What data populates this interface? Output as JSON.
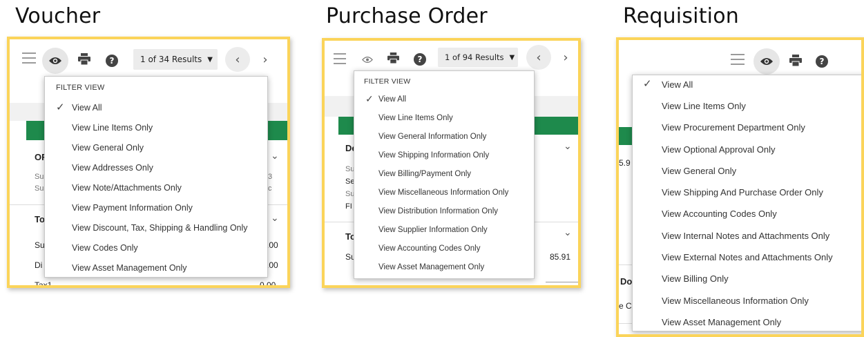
{
  "panels": {
    "voucher": {
      "title": "Voucher",
      "results_label": "1 of 34 Results",
      "filter_header": "FILTER VIEW",
      "items": [
        "View All",
        "View Line Items Only",
        "View General Only",
        "View Addresses Only",
        "View Note/Attachments Only",
        "View Payment Information Only",
        "View Discount, Tax, Shipping & Handling Only",
        "View Codes Only",
        "View Asset Management Only"
      ],
      "selected_item": "View All",
      "background_text": {
        "section1": "OF",
        "sub1": "Su",
        "sub2": "Su",
        "val1": "3",
        "val2": "c",
        "section2": "To",
        "row1": "Su",
        "row1_val": ".00",
        "row2": "Di",
        "row2_val": ".00",
        "row3": "Tax1",
        "row3_val": "0.00"
      }
    },
    "purchase_order": {
      "title": "Purchase Order",
      "results_label": "1 of 94 Results",
      "filter_header": "FILTER VIEW",
      "items": [
        "View All",
        "View Line Items Only",
        "View General Information Only",
        "View Shipping Information Only",
        "View Billing/Payment Only",
        "View Miscellaneous Information Only",
        "View Distribution Information Only",
        "View Supplier Information Only",
        "View Accounting Codes Only",
        "View Asset Management Only"
      ],
      "selected_item": "View All",
      "background_text": {
        "section1": "De",
        "sub1": "Su",
        "sub2": "Se",
        "sub3": "Su",
        "sub4": "FI",
        "section2": "To",
        "row1": "Su",
        "row1_val": "85.91"
      }
    },
    "requisition": {
      "title": "Requisition",
      "items": [
        "View All",
        "View Line Items Only",
        "View Procurement Department Only",
        "View Optional Approval Only",
        "View General Only",
        "View Shipping And Purchase Order Only",
        "View Accounting Codes Only",
        "View Internal Notes and Attachments Only",
        "View External Notes and Attachments Only",
        "View Billing Only",
        "View Miscellaneous Information Only",
        "View Asset Management Only"
      ],
      "selected_item": "View All",
      "background_text": {
        "val1": "5.9",
        "section1": "Do",
        "sub1": "e C"
      }
    }
  },
  "colors": {
    "frame_border": "#fbd45a",
    "header_green": "#1e8a4c",
    "active_icon_bg": "#e6e6e6"
  },
  "icons": [
    "menu-icon",
    "eye-icon",
    "print-icon",
    "help-icon",
    "caret-down-icon",
    "chevron-left-icon",
    "chevron-right-icon",
    "chevron-down-icon",
    "check-icon"
  ]
}
